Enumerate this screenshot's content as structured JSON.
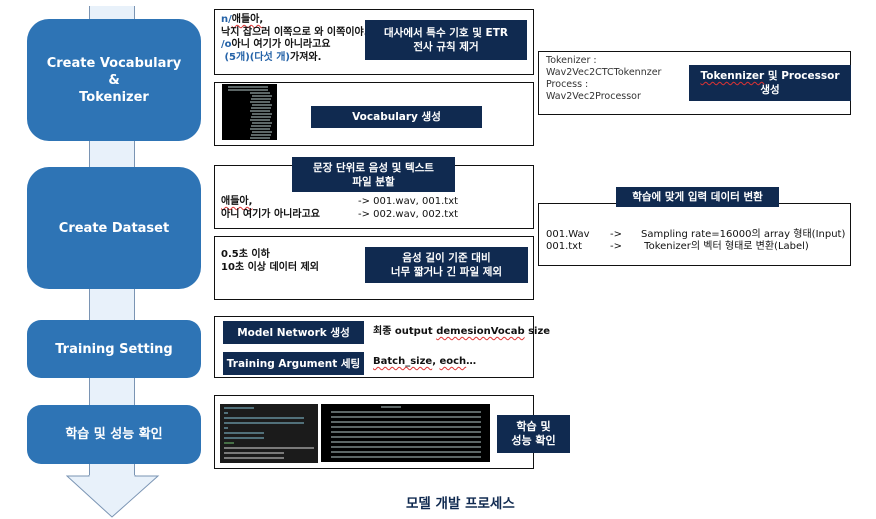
{
  "colors": {
    "stage_fill": "#2e74b5",
    "tag_fill": "#102a50",
    "arrow_fill": "#e8f1fa",
    "arrow_stroke": "#7a94b3",
    "highlight_text": "#2563a8"
  },
  "stages": [
    {
      "label": "Create Vocabulary\n&\nTokenizer"
    },
    {
      "label": "Create Dataset"
    },
    {
      "label": "Training Setting"
    },
    {
      "label": "학습 및 성능 확인"
    }
  ],
  "vocab": {
    "script_lines": [
      {
        "prefix": "n/",
        "text": "애들아,"
      },
      {
        "prefix": "",
        "text": "낙지 잡으러 이쪽으로 와 이쪽이야."
      },
      {
        "prefix": "/o",
        "text": "아니 여기가 아니라고요"
      },
      {
        "prefix": " (5개)(다섯 개)",
        "text": "가져와."
      }
    ],
    "cleanup_tag": "대사에서 특수 기호 및 ETR\n전사 규칙 제거",
    "vocab_tag": "Vocabulary 생성",
    "tokenizer_info": "Tokenizer :\nWav2Vec2CTCTokennzer\nProcess :\nWav2Vec2Processor",
    "tokenizer_tag_line1": "Tokennizer",
    "tokenizer_tag_line1_rest": " 및 Processor",
    "tokenizer_tag_line2": "생성"
  },
  "dataset": {
    "split_tag": "문장 단위로 음성 및 텍스트\n파일 분할",
    "split_rows": [
      {
        "sentence": "애들아,",
        "arrow": "-> 001.wav, 001.txt"
      },
      {
        "sentence": "아니 여기가 아니라고요",
        "arrow": "-> 002.wav, 002.txt"
      }
    ],
    "filter_text": "0.5초 이하\n10초 이상 데이터 제외",
    "filter_tag": "음성 길이 기준 대비\n너무 짧거나 긴 파일 제외",
    "convert_tag": "학습에 맞게 입력 데이터 변환",
    "convert_rows": [
      {
        "file": "001.Wav",
        "arrow": "->",
        "desc": "Sampling rate=16000의 array 형태(Input)"
      },
      {
        "file": "001.txt",
        "arrow": "->",
        "desc": " Tokenizer의 벡터 형태로 변환(Label)"
      }
    ]
  },
  "training": {
    "model_tag": "Model Network 생성",
    "model_note_prefix": "최종 output ",
    "model_note_squig": "demesionVocab",
    "model_note_suffix": " size",
    "args_tag": "Training Argument 세팅",
    "args_note_a": "Batch_size",
    "args_note_sep": ", ",
    "args_note_b": "eoch",
    "args_note_tail": "…"
  },
  "evaluation": {
    "tag": "학습 및\n성능 확인"
  },
  "footer": {
    "title": "모델 개발 프로세스"
  }
}
